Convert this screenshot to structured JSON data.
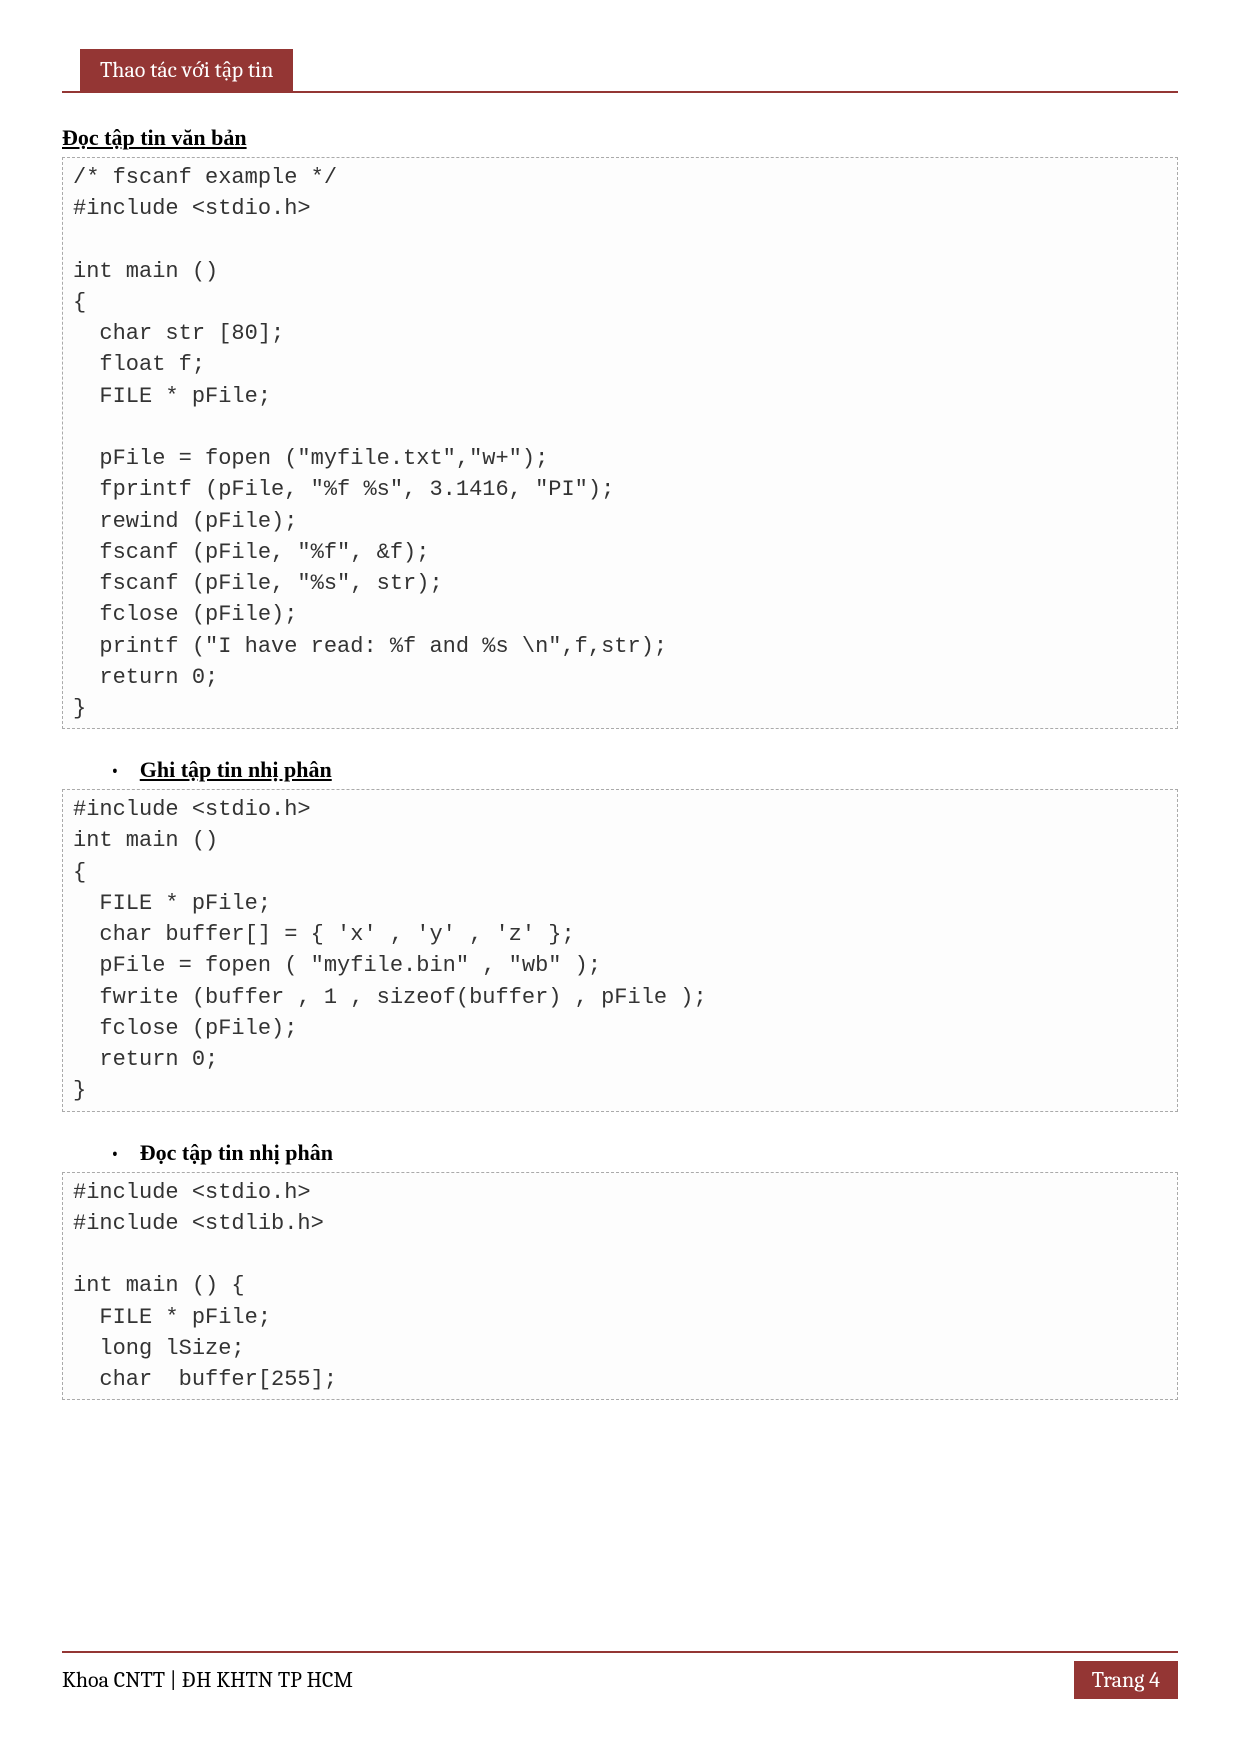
{
  "header": {
    "title": "Thao tác với tập tin"
  },
  "sections": {
    "s1": {
      "title": "Đọc tập tin văn bản",
      "code": "/* fscanf example */\n#include <stdio.h>\n\nint main ()\n{\n  char str [80];\n  float f;\n  FILE * pFile;\n\n  pFile = fopen (\"myfile.txt\",\"w+\");\n  fprintf (pFile, \"%f %s\", 3.1416, \"PI\");\n  rewind (pFile);\n  fscanf (pFile, \"%f\", &f);\n  fscanf (pFile, \"%s\", str);\n  fclose (pFile);\n  printf (\"I have read: %f and %s \\n\",f,str);\n  return 0;\n}"
    },
    "s2": {
      "title": "Ghi tập tin nhị phân",
      "code": "#include <stdio.h>\nint main ()\n{\n  FILE * pFile;\n  char buffer[] = { 'x' , 'y' , 'z' };\n  pFile = fopen ( \"myfile.bin\" , \"wb\" );\n  fwrite (buffer , 1 , sizeof(buffer) , pFile );\n  fclose (pFile);\n  return 0;\n}"
    },
    "s3": {
      "title": "Đọc tập tin nhị phân",
      "code": "#include <stdio.h>\n#include <stdlib.h>\n\nint main () {\n  FILE * pFile;\n  long lSize;\n  char  buffer[255];"
    }
  },
  "footer": {
    "left": "Khoa CNTT | ĐH KHTN TP HCM",
    "right": "Trang 4"
  }
}
